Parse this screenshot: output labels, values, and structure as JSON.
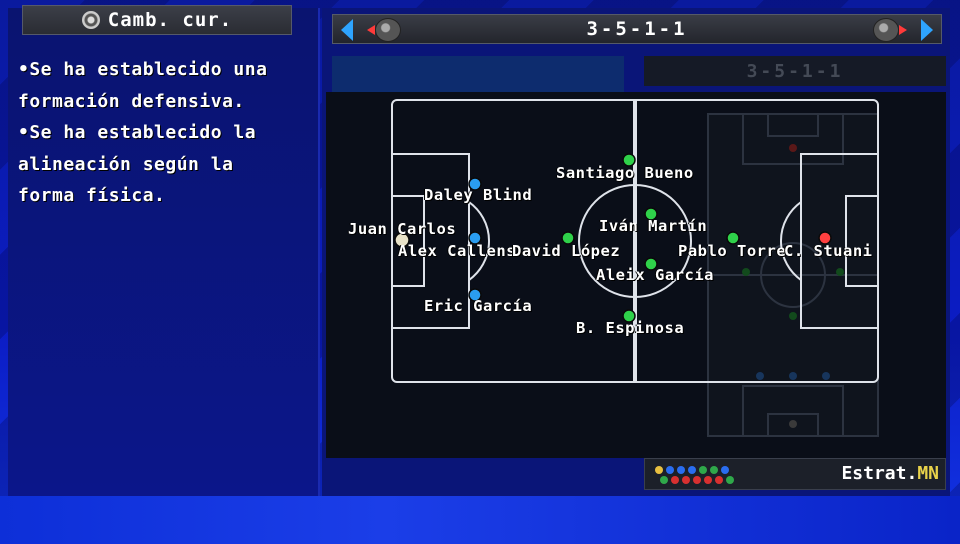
{
  "header": {
    "title": "Camb. cur.",
    "icon": "circle-button-icon"
  },
  "info": {
    "lines": [
      "•Se ha establecido una",
      "formación defensiva.",
      "•Se ha establecido la",
      "alineación según la",
      "forma física."
    ]
  },
  "formation_bar": {
    "label": "3-5-1-1",
    "left_arrow_icon": "chevron-left-icon",
    "right_arrow_icon": "chevron-right-icon",
    "swap_icon": "ball-swap-icon"
  },
  "opponent_formation": {
    "label": "3-5-1-1"
  },
  "players": [
    {
      "name": "Juan Carlos",
      "role": "goalkeeper",
      "color": "#e8e2c8"
    },
    {
      "name": "Daley Blind",
      "role": "defender",
      "color": "#2a9df0"
    },
    {
      "name": "Alex Callens",
      "role": "defender",
      "color": "#2a9df0"
    },
    {
      "name": "Eric García",
      "role": "defender",
      "color": "#2a9df0"
    },
    {
      "name": "Santiago Bueno",
      "role": "midfielder",
      "color": "#2fd14a"
    },
    {
      "name": "Iván Martín",
      "role": "midfielder",
      "color": "#2fd14a"
    },
    {
      "name": "David López",
      "role": "midfielder",
      "color": "#2fd14a"
    },
    {
      "name": "Aleix García",
      "role": "midfielder",
      "color": "#2fd14a"
    },
    {
      "name": "B. Espinosa",
      "role": "midfielder",
      "color": "#2fd14a"
    },
    {
      "name": "Pablo Torre",
      "role": "midfielder",
      "color": "#2fd14a"
    },
    {
      "name": "C. Stuani",
      "role": "forward",
      "color": "#ff4040"
    }
  ],
  "strategy": {
    "label": "Estrat.",
    "suffix": "MN"
  },
  "colors": {
    "defender": "#2a9df0",
    "midfielder": "#2fd14a",
    "forward": "#ff4040",
    "goalkeeper": "#e8e2c8",
    "accent_yellow": "#e8d24a"
  }
}
